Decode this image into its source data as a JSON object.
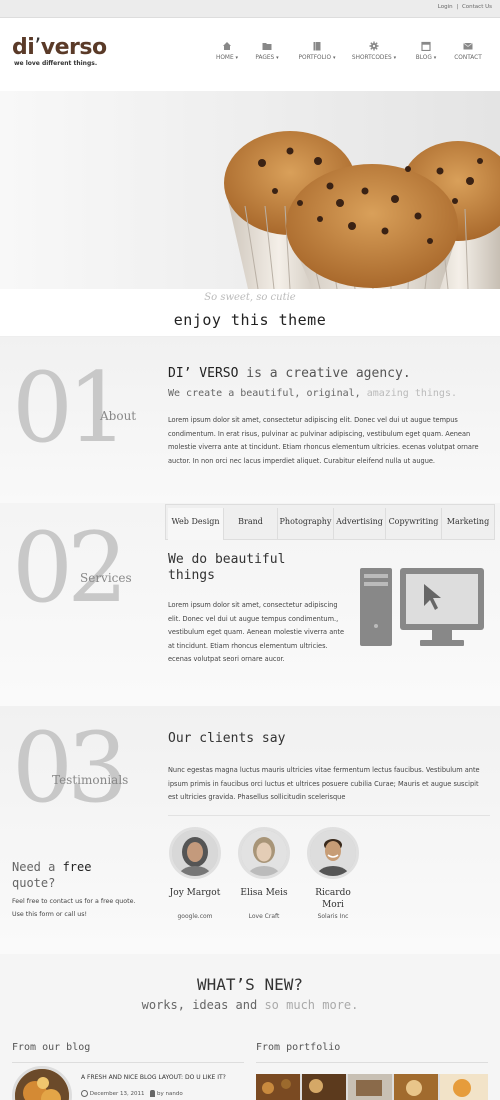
{
  "topbar": {
    "login": "Login",
    "separator": "|",
    "contact": "Contact Us"
  },
  "header": {
    "logo_main": "di",
    "logo_quote": "’",
    "logo_rest": "verso",
    "tagline": "we love different things.",
    "nav": [
      {
        "label": "HOME",
        "icon": "home-icon",
        "dropdown": true
      },
      {
        "label": "PAGES",
        "icon": "folder-icon",
        "dropdown": true
      },
      {
        "label": "PORTFOLIO",
        "icon": "book-icon",
        "dropdown": true
      },
      {
        "label": "SHORTCODES",
        "icon": "gear-icon",
        "dropdown": true
      },
      {
        "label": "BLOG",
        "icon": "calendar-icon",
        "dropdown": true
      },
      {
        "label": "CONTACT",
        "icon": "mail-icon",
        "dropdown": false
      }
    ]
  },
  "hero": {
    "caption_small": "So sweet, so cutie",
    "caption_big": "enjoy this theme"
  },
  "about": {
    "number": "01",
    "label": "About",
    "heading_strong": "DI’ VERSO",
    "heading_rest": " is a creative agency.",
    "subheading_a": "We create a beautiful, original, ",
    "subheading_b": "amazing things.",
    "body": "Lorem ipsum dolor sit amet, consectetur adipiscing elit. Donec vel dui ut augue tempus condimentum. In erat risus, pulvinar ac pulvinar adipiscing, vestibulum eget quam. Aenean molestie viverra ante at tincidunt. Etiam rhoncus elementum ultricies. ecenas volutpat ornare auctor. In non orci nec lacus imperdiet aliquet. Curabitur eleifend nulla ut augue."
  },
  "services": {
    "number": "02",
    "label": "Services",
    "tabs": [
      "Web Design",
      "Brand",
      "Photography",
      "Advertising",
      "Copywriting",
      "Marketing"
    ],
    "heading": "We do beautiful things",
    "body": "Lorem ipsum dolor sit amet, consectetur adipiscing elit. Donec vel dui ut augue tempus condimentum., vestibulum eget quam. Aenean molestie viverra ante at tincidunt. Etiam rhoncus elementum ultricies. ecenas volutpat seori ornare aucor."
  },
  "testimonials": {
    "number": "03",
    "label": "Testimonials",
    "heading": "Our clients say",
    "quote": "Nunc egestas magna luctus mauris ultricies vitae fermentum lectus faucibus. Vestibulum ante ipsum primis in faucibus orci luctus et ultrices posuere cubilia Curae; Mauris et augue suscipit est ultricies gravida. Phasellus sollicitudin scelerisque",
    "quote_cta_a": "Need a ",
    "quote_cta_b": "free",
    "quote_cta_c": "quote?",
    "quote_text": "Feel free to contact us for a free quote. Use this form or call us!",
    "clients": [
      {
        "name": "Joy Margot",
        "company": "google.com"
      },
      {
        "name": "Elisa Meis",
        "company": "Love Craft"
      },
      {
        "name": "Ricardo Mori",
        "company": "Solaris Inc"
      }
    ]
  },
  "whatsnew": {
    "title": "WHAT’S NEW?",
    "subtitle_a": "works, ideas and ",
    "subtitle_b": "so much more.",
    "blog_heading": "From our blog",
    "portfolio_heading": "From portfolio",
    "post_title": "A FRESH AND NICE BLOG LAYOUT: DO U LIKE IT?",
    "post_date": "December 13, 2011",
    "post_author": "by nando"
  }
}
